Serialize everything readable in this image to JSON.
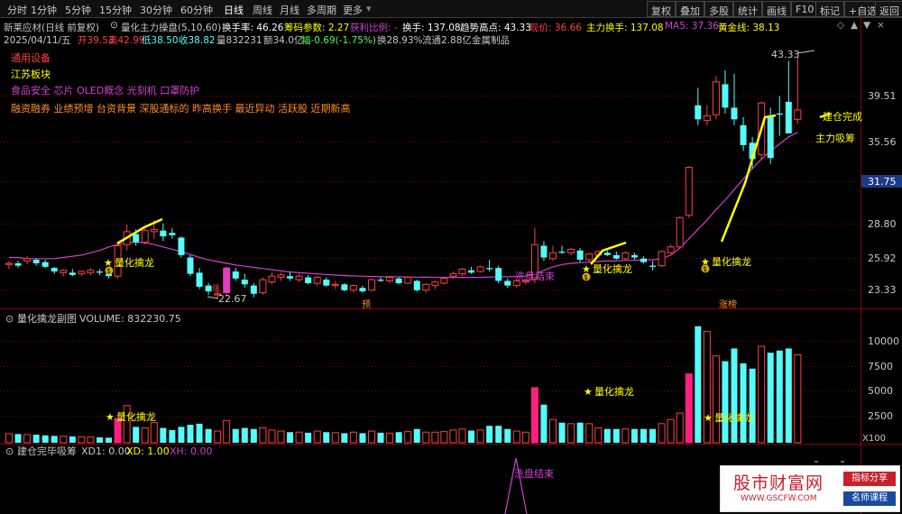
{
  "toolbar": {
    "periods": [
      "分时",
      "1分钟",
      "5分钟",
      "15分钟",
      "30分钟",
      "60分钟",
      "日线",
      "周线",
      "月线",
      "多周期",
      "更多"
    ],
    "active_period": "日线",
    "right_buttons": [
      "复权",
      "叠加",
      "多股",
      "统计",
      "画线",
      "F10",
      "标记",
      "+自选",
      "返回"
    ]
  },
  "header": {
    "stock": "新莱应材(日线 前复权)",
    "indicator": "量化主力操盘(5,10,60)",
    "turnover_rate_label": "换手率: 46.26",
    "chip_label": "筹码参数: 2.27",
    "profit_ratio_label": "获利比例: -",
    "turnover_label": "换手: 137.08",
    "trend_high_label": "趋势高点: 43.33",
    "current_price_label": "现价: 36.66",
    "main_turnover_label": "主力换手: 137.08",
    "ma5_label": "MA5: 37.36",
    "golden_label": "黄金线: 38.13"
  },
  "quote": {
    "date": "2025/04/11/五",
    "open": "开39.53",
    "high": "高42.99",
    "low": "低38.50",
    "close": "收38.82",
    "volume": "量832231",
    "amount": "额34.0亿",
    "change": "幅-0.69(-1.75%)",
    "turnover": "换28.93%",
    "float_cap": "流通2.88亿",
    "industry": "金属制品"
  },
  "concepts": {
    "line1": "通用设备",
    "line2": "江苏板块",
    "line3": "食品安全 芯片 OLED概念 光刻机 口罩防护",
    "line4": "融资融券 业绩预增 台资背景 深股通标的 昨高换手 最近异动 活跃股 近期新高"
  },
  "price_axis": [
    "39.51",
    "35.56",
    "31.75",
    "28.80",
    "25.92",
    "23.33"
  ],
  "price_marks": {
    "high": "43.33",
    "low": "22.67",
    "tag_pre": "预",
    "tag_rise": "涨",
    "tag_rise2": "涨榜",
    "signal": "量化擒龙",
    "washout": "洗盘结束",
    "build": "建仓完成",
    "absorb": "主力吸筹",
    "dollar": "$"
  },
  "volume_panel": {
    "title": "量化擒龙副图",
    "volume_label": "VOLUME: 832230.75",
    "axis": [
      "10000",
      "7500",
      "5000",
      "2500"
    ],
    "unit": "X100",
    "signal": "量化擒龙"
  },
  "bottom_panel": {
    "title": "建仓完毕吸筹",
    "xd1": "XD1: 0.00",
    "xd": "XD: 1.00",
    "xh": "XH: 0.00",
    "washout": "洗盘结束"
  },
  "watermark": {
    "brand": "股市财富网",
    "url": "WWW.GSCFW.COM",
    "tag1": "指标分享",
    "tag2": "名师课程"
  },
  "colors": {
    "up": "#ff4040",
    "down": "#54fcfc",
    "ma": "#d040d0",
    "accent": "#ffff00",
    "grid": "#8b0000"
  },
  "chart_data": {
    "type": "candlestick",
    "price_range": [
      22.0,
      44.5
    ],
    "candles": [
      [
        25.6,
        25.9,
        25.2,
        25.7
      ],
      [
        25.7,
        25.9,
        25.3,
        25.5
      ],
      [
        25.9,
        26.3,
        25.6,
        26.1
      ],
      [
        26.0,
        26.1,
        25.5,
        25.7
      ],
      [
        25.8,
        26.0,
        25.3,
        25.4
      ],
      [
        25.3,
        25.4,
        24.8,
        25.0
      ],
      [
        24.9,
        25.2,
        24.6,
        25.1
      ],
      [
        24.9,
        25.2,
        24.6,
        24.7
      ],
      [
        24.8,
        25.1,
        24.6,
        25.0
      ],
      [
        24.9,
        25.3,
        24.7,
        25.1
      ],
      [
        25.0,
        25.2,
        24.7,
        24.9
      ],
      [
        24.8,
        25.0,
        24.4,
        24.6
      ],
      [
        24.6,
        27.3,
        24.4,
        27.2
      ],
      [
        27.3,
        29.0,
        26.8,
        28.4
      ],
      [
        28.2,
        28.6,
        27.2,
        27.5
      ],
      [
        27.5,
        28.8,
        27.3,
        28.5
      ],
      [
        28.4,
        29.4,
        27.8,
        28.6
      ],
      [
        28.5,
        29.1,
        27.6,
        28.0
      ],
      [
        28.3,
        28.7,
        27.8,
        28.1
      ],
      [
        27.9,
        28.0,
        26.2,
        26.4
      ],
      [
        26.2,
        26.4,
        24.6,
        24.8
      ],
      [
        24.9,
        25.3,
        23.5,
        23.7
      ],
      [
        23.8,
        24.0,
        23.0,
        23.3
      ],
      [
        23.0,
        23.3,
        22.7,
        23.1
      ],
      [
        23.2,
        25.4,
        23.0,
        25.3
      ],
      [
        25.0,
        25.3,
        24.2,
        24.4
      ],
      [
        24.3,
        24.8,
        23.6,
        23.9
      ],
      [
        23.8,
        24.0,
        22.8,
        23.1
      ],
      [
        23.2,
        24.5,
        23.0,
        24.3
      ],
      [
        24.1,
        24.9,
        23.9,
        24.6
      ],
      [
        24.5,
        24.9,
        24.2,
        24.7
      ],
      [
        24.6,
        25.0,
        24.2,
        24.4
      ],
      [
        24.3,
        24.8,
        24.1,
        24.6
      ],
      [
        24.5,
        24.7,
        23.9,
        24.0
      ],
      [
        24.0,
        24.6,
        23.8,
        24.5
      ],
      [
        24.3,
        24.5,
        23.7,
        23.8
      ],
      [
        23.8,
        24.2,
        23.5,
        23.9
      ],
      [
        23.9,
        24.0,
        23.3,
        23.4
      ],
      [
        23.4,
        23.9,
        23.2,
        23.8
      ],
      [
        23.6,
        23.8,
        23.2,
        23.3
      ],
      [
        23.4,
        24.4,
        23.3,
        24.3
      ],
      [
        24.3,
        24.5,
        24.1,
        24.2
      ],
      [
        24.2,
        24.6,
        24.0,
        24.5
      ],
      [
        24.4,
        24.5,
        23.9,
        24.0
      ],
      [
        24.0,
        24.6,
        23.9,
        24.5
      ],
      [
        24.2,
        24.3,
        23.3,
        23.4
      ],
      [
        23.4,
        24.0,
        23.2,
        23.9
      ],
      [
        23.8,
        24.2,
        23.5,
        24.1
      ],
      [
        24.0,
        24.5,
        23.9,
        24.4
      ],
      [
        24.6,
        25.0,
        24.4,
        24.8
      ],
      [
        24.8,
        25.3,
        24.6,
        25.2
      ],
      [
        25.1,
        25.4,
        24.8,
        24.9
      ],
      [
        25.0,
        25.5,
        24.9,
        25.4
      ],
      [
        25.3,
        26.0,
        25.0,
        25.2
      ],
      [
        25.3,
        25.5,
        24.0,
        24.2
      ],
      [
        24.2,
        24.4,
        23.6,
        23.8
      ],
      [
        23.8,
        24.3,
        23.6,
        24.2
      ],
      [
        24.1,
        24.4,
        23.9,
        24.2
      ],
      [
        24.4,
        28.7,
        24.0,
        27.3
      ],
      [
        27.2,
        27.6,
        25.9,
        26.2
      ],
      [
        26.1,
        27.2,
        25.9,
        26.6
      ],
      [
        26.7,
        27.2,
        26.5,
        26.6
      ],
      [
        26.6,
        27.0,
        26.4,
        26.9
      ],
      [
        26.8,
        27.0,
        25.8,
        26.0
      ],
      [
        26.0,
        26.6,
        25.8,
        26.5
      ],
      [
        26.4,
        26.8,
        26.2,
        26.7
      ],
      [
        26.6,
        26.8,
        26.3,
        26.4
      ],
      [
        26.4,
        26.7,
        26.0,
        26.1
      ],
      [
        26.1,
        26.7,
        26.0,
        26.6
      ],
      [
        26.4,
        26.6,
        26.0,
        26.2
      ],
      [
        26.1,
        26.3,
        25.7,
        25.8
      ],
      [
        25.5,
        25.9,
        25.1,
        25.4
      ],
      [
        25.5,
        26.8,
        25.4,
        26.7
      ],
      [
        26.6,
        27.3,
        26.5,
        27.1
      ],
      [
        27.1,
        29.7,
        27.0,
        29.6
      ],
      [
        29.8,
        34.0,
        29.6,
        33.9
      ],
      [
        39.2,
        40.7,
        37.5,
        38.0
      ],
      [
        37.9,
        39.2,
        37.5,
        38.3
      ],
      [
        38.4,
        41.7,
        38.0,
        41.2
      ],
      [
        41.0,
        42.2,
        38.5,
        39.0
      ],
      [
        39.0,
        41.9,
        37.5,
        38.0
      ],
      [
        37.5,
        38.2,
        35.3,
        35.8
      ],
      [
        36.0,
        36.5,
        33.8,
        34.6
      ],
      [
        35.0,
        39.5,
        34.5,
        39.4
      ],
      [
        38.2,
        39.0,
        34.2,
        34.7
      ],
      [
        38.5,
        40.0,
        36.6,
        38.4
      ],
      [
        39.5,
        43.0,
        36.8,
        36.8
      ],
      [
        38.0,
        43.3,
        37.6,
        38.8
      ]
    ],
    "volume": [
      850,
      820,
      780,
      760,
      700,
      650,
      620,
      600,
      560,
      540,
      510,
      480,
      2300,
      3500,
      1500,
      1400,
      1900,
      1400,
      1200,
      1500,
      1700,
      1800,
      1300,
      1100,
      2100,
      1300,
      1400,
      1300,
      1400,
      1200,
      1100,
      1000,
      1000,
      950,
      1100,
      1000,
      950,
      900,
      1000,
      900,
      1100,
      950,
      900,
      1000,
      1050,
      1300,
      1000,
      1000,
      1050,
      1200,
      1300,
      1150,
      1200,
      1600,
      1600,
      1300,
      1100,
      1000,
      5200,
      3600,
      2200,
      1900,
      1800,
      1900,
      1800,
      1400,
      1300,
      1300,
      1300,
      1300,
      1300,
      1300,
      1800,
      2200,
      2800,
      6500,
      11000,
      10500,
      8200,
      7700,
      8900,
      7500,
      7000,
      9100,
      8500,
      8700,
      8900,
      8300
    ],
    "ma": [
      26.2,
      26.2,
      26.1,
      26.1,
      26.1,
      26.1,
      26.2,
      26.3,
      26.4,
      26.6,
      26.8,
      27.1,
      27.3,
      27.45,
      27.5,
      27.45,
      27.3,
      27.1,
      26.9,
      26.7,
      26.45,
      26.2,
      26.0,
      25.85,
      25.7,
      25.55,
      25.45,
      25.35,
      25.25,
      25.15,
      25.05,
      24.95,
      24.9,
      24.85,
      24.8,
      24.75,
      24.7,
      24.65,
      24.62,
      24.6,
      24.58,
      24.56,
      24.55,
      24.54,
      24.53,
      24.52,
      24.51,
      24.5,
      24.5,
      24.5,
      24.5,
      24.5,
      24.5,
      24.52,
      24.55,
      24.55,
      24.57,
      24.6,
      24.8,
      25.1,
      25.4,
      25.6,
      25.7,
      25.75,
      25.8,
      25.85,
      25.9,
      25.9,
      25.95,
      25.95,
      26.0,
      26.0,
      26.1,
      26.4,
      27.0,
      27.8,
      28.6,
      29.4,
      30.3,
      31.1,
      32.0,
      32.9,
      33.8,
      34.6,
      35.3,
      35.9,
      36.5,
      36.9
    ]
  }
}
